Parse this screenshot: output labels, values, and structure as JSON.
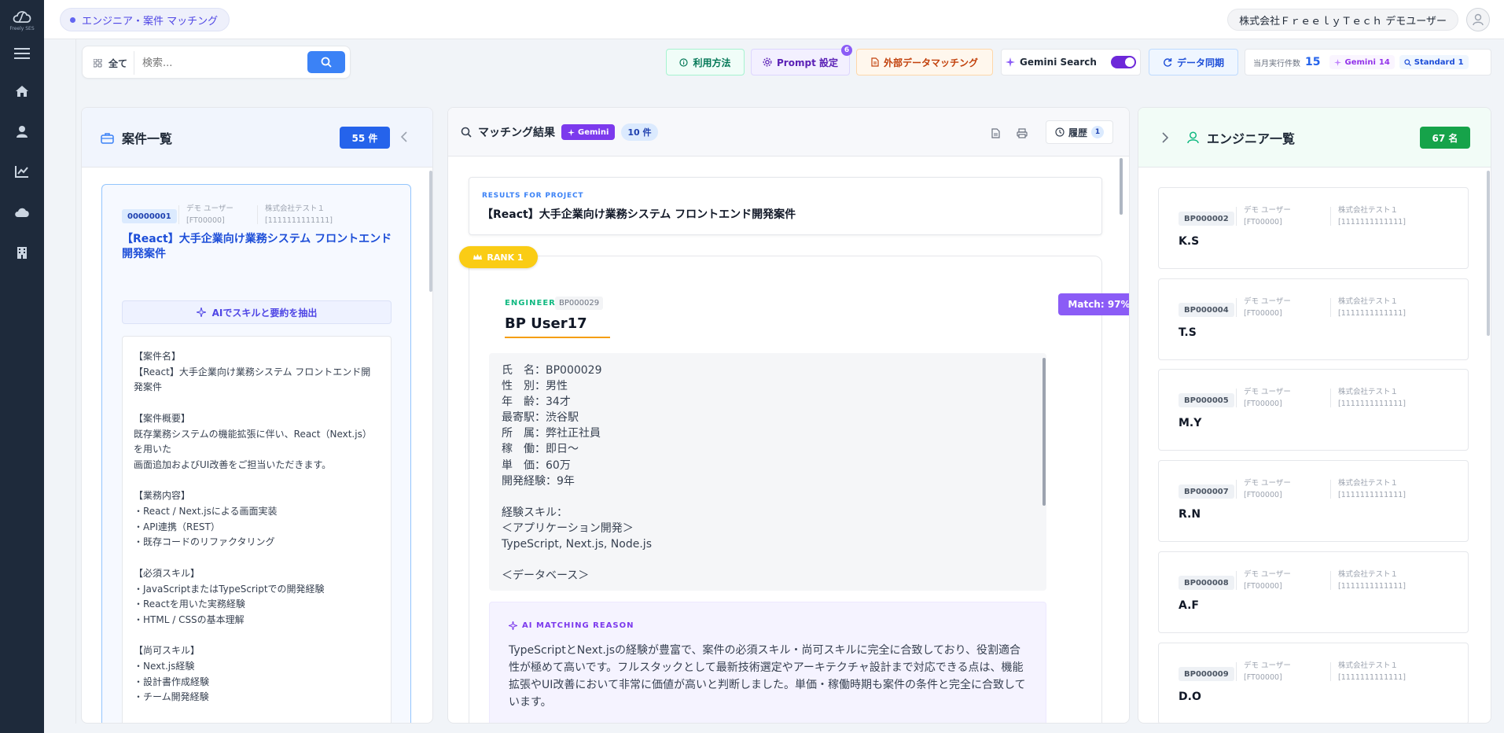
{
  "brand": {
    "logo_sub": "Freely SES"
  },
  "header": {
    "app_name": "エンジニア・案件 マッチング",
    "user": "株式会社ＦｒｅｅｌｙＴｅｃｈ デモユーザー"
  },
  "toolbar": {
    "filter_label": "全て",
    "search_placeholder": "検索...",
    "usage_label": "利用方法",
    "prompt_label": "Prompt 設定",
    "prompt_count": "6",
    "external_label": "外部データマッチング",
    "gemini_search_label": "Gemini Search",
    "gemini_search_on": true,
    "sync_label": "データ同期",
    "monthly_label": "当月実行件数",
    "monthly_count": "15",
    "gemini_chip_label": "Gemini",
    "gemini_chip_count": "14",
    "standard_chip_label": "Standard",
    "standard_chip_count": "1"
  },
  "left": {
    "title": "案件一覧",
    "count": "55 件",
    "card": {
      "id": "00000001",
      "owner": "デモ ユーザー",
      "owner_code": "[FT00000]",
      "company": "株式会社テスト１",
      "company_code": "[1111111111111]",
      "title": "【React】大手企業向け業務システム フロントエンド開発案件",
      "ai_button": "AIでスキルと要約を抽出",
      "description": "【案件名】\n【React】大手企業向け業務システム フロントエンド開発案件\n\n【案件概要】\n既存業務システムの機能拡張に伴い、React（Next.js）を用いた\n画面追加およびUI改善をご担当いただきます。\n\n【業務内容】\n・React / Next.jsによる画面実装\n・API連携（REST）\n・既存コードのリファクタリング\n\n【必須スキル】\n・JavaScriptまたはTypeScriptでの開発経験\n・Reactを用いた実務経験\n・HTML / CSSの基本理解\n\n【尚可スキル】\n・Next.js経験\n・設計書作成経験\n・チーム開発経験"
    }
  },
  "middle": {
    "title": "マッチング結果",
    "gemini_badge": "Gemini",
    "count": "10 件",
    "history_label": "履歴",
    "history_count": "1",
    "results_for_label": "RESULTS FOR PROJECT",
    "results_for_value": "【React】大手企業向け業務システム フロントエンド開発案件",
    "rank_label": "RANK 1",
    "engineer_label": "ENGINEER",
    "engineer_id": "BP000029",
    "engineer_name": "BP User17",
    "match": "Match: 97%",
    "profile": "氏　名：BP000029\n性　別：男性\n年　齢：34才\n最寄駅：渋谷駅\n所　属：弊社正社員\n稼　働：即日〜\n単　価：60万\n開発経験：9年\n\n経験スキル：\n＜アプリケーション開発＞\nTypeScript, Next.js, Node.js\n\n＜データベース＞",
    "reason_label": "AI MATCHING REASON",
    "reason": "TypeScriptとNext.jsの経験が豊富で、案件の必須スキル・尚可スキルに完全に合致しており、役割適合性が極めて高いです。フルスタックとして最新技術選定やアーキテクチャ設計まで対応できる点は、機能拡張やUI改善において非常に価値が高いと判断しました。単価・稼働時期も案件の条件と完全に合致しています。"
  },
  "right": {
    "title": "エンジニア一覧",
    "count": "67 名",
    "engineers": [
      {
        "id": "BP000002",
        "owner": "デモ ユーザー",
        "owner_code": "[FT00000]",
        "company": "株式会社テスト１",
        "company_code": "[1111111111111]",
        "name": "K.S"
      },
      {
        "id": "BP000004",
        "owner": "デモ ユーザー",
        "owner_code": "[FT00000]",
        "company": "株式会社テスト１",
        "company_code": "[1111111111111]",
        "name": "T.S"
      },
      {
        "id": "BP000005",
        "owner": "デモ ユーザー",
        "owner_code": "[FT00000]",
        "company": "株式会社テスト１",
        "company_code": "[1111111111111]",
        "name": "M.Y"
      },
      {
        "id": "BP000007",
        "owner": "デモ ユーザー",
        "owner_code": "[FT00000]",
        "company": "株式会社テスト１",
        "company_code": "[1111111111111]",
        "name": "R.N"
      },
      {
        "id": "BP000008",
        "owner": "デモ ユーザー",
        "owner_code": "[FT00000]",
        "company": "株式会社テスト１",
        "company_code": "[1111111111111]",
        "name": "A.F"
      },
      {
        "id": "BP000009",
        "owner": "デモ ユーザー",
        "owner_code": "[FT00000]",
        "company": "株式会社テスト１",
        "company_code": "[1111111111111]",
        "name": "D.O"
      }
    ]
  },
  "colors": {
    "primary": "#3b82f6",
    "accent": "#7c3aed",
    "success": "#10b981",
    "rank": "#facc15",
    "sidebar": "#1e2a3b"
  }
}
